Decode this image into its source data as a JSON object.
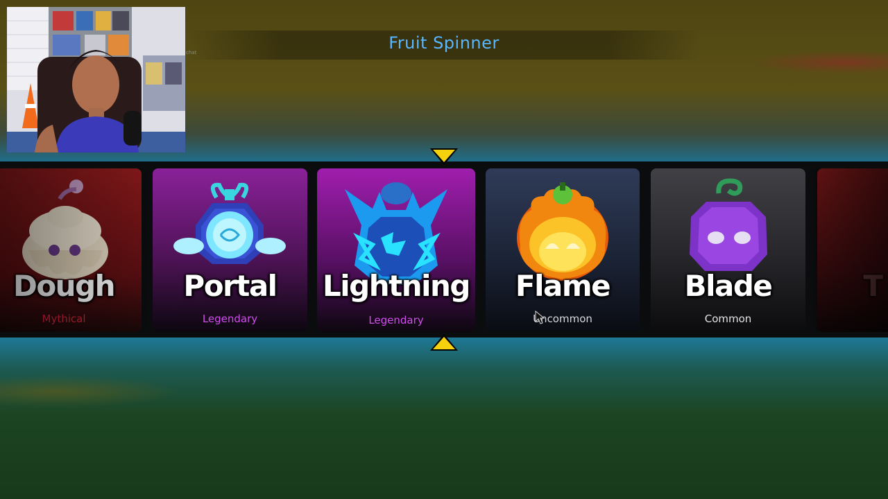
{
  "game": {
    "title": "Fruit Spinner"
  },
  "webcam": {
    "overlay_text": "chat"
  },
  "spinner": {
    "cards": [
      {
        "name": "Dough",
        "rarity": "Mythical",
        "rarity_color": "#d6203c",
        "bg": "#7e1517",
        "fruit_icon": "dough-fruit-icon"
      },
      {
        "name": "Portal",
        "rarity": "Legendary",
        "rarity_color": "#d24cf0",
        "bg": "#741c86",
        "fruit_icon": "portal-fruit-icon"
      },
      {
        "name": "Lightning",
        "rarity": "Legendary",
        "rarity_color": "#d24cf0",
        "bg": "#8a1a97",
        "fruit_icon": "lightning-fruit-icon"
      },
      {
        "name": "Flame",
        "rarity": "Uncommon",
        "rarity_color": "#d7d7df",
        "bg": "#2a3650",
        "fruit_icon": "flame-fruit-icon"
      },
      {
        "name": "Blade",
        "rarity": "Common",
        "rarity_color": "#e4e4e4",
        "bg": "#3a3a3e",
        "fruit_icon": "blade-fruit-icon"
      }
    ],
    "partial_card_label": "T",
    "selected_index": 2,
    "marker_color": "#f6d20e"
  }
}
